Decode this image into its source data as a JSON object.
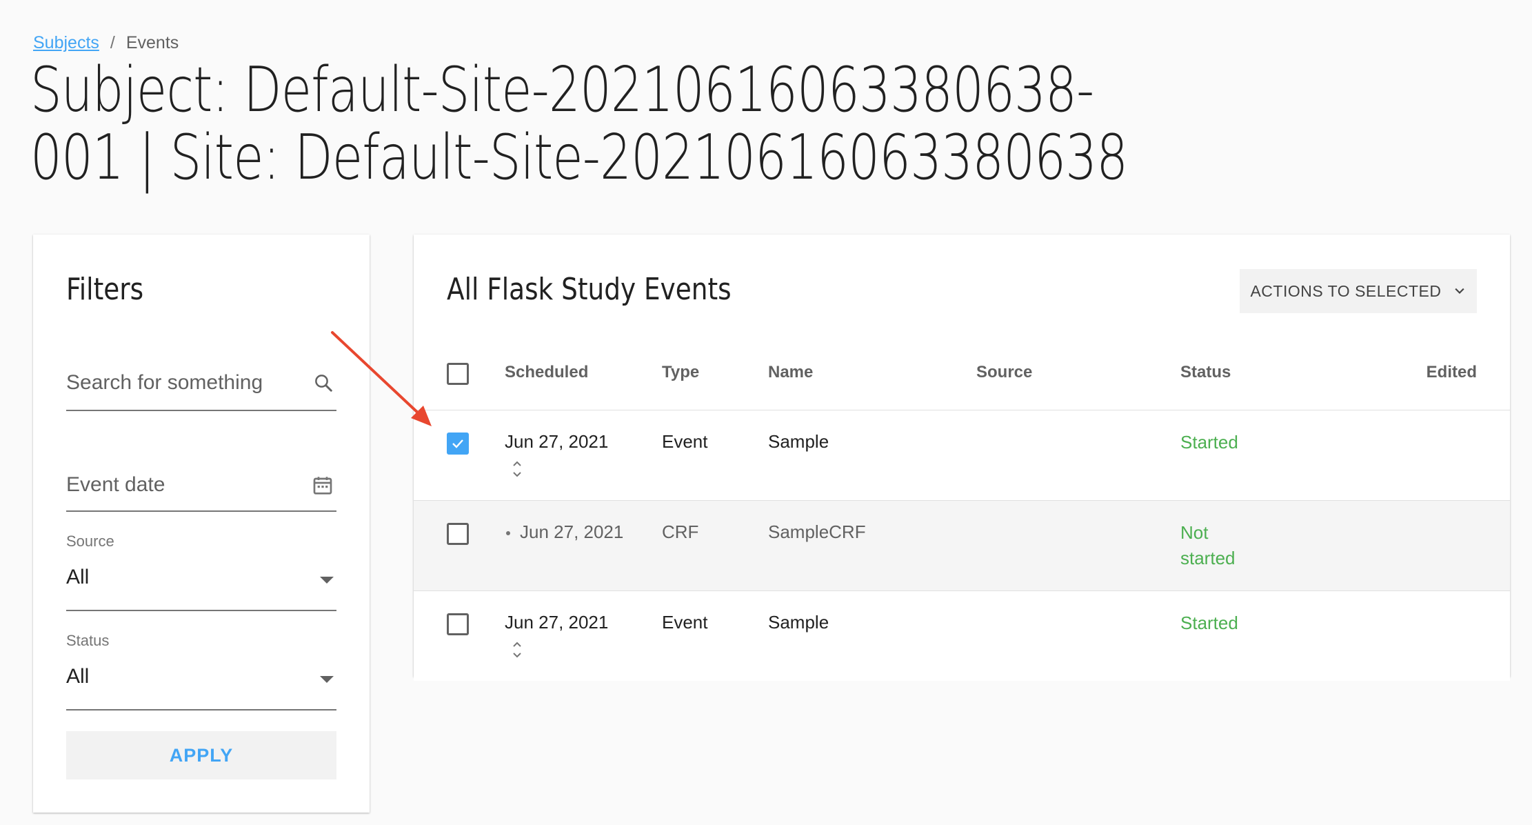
{
  "breadcrumb": {
    "link": "Subjects",
    "separator": "/",
    "current": "Events"
  },
  "page_title": "Subject: Default-Site-20210616063380638-001 | Site: Default-Site-20210616063380638",
  "filters": {
    "title": "Filters",
    "search_placeholder": "Search for something",
    "event_date_placeholder": "Event date",
    "source_label": "Source",
    "source_value": "All",
    "status_label": "Status",
    "status_value": "All",
    "apply_label": "APPLY"
  },
  "events": {
    "title": "All Flask Study Events",
    "actions_label": "ACTIONS TO SELECTED",
    "columns": [
      "Scheduled",
      "Type",
      "Name",
      "Source",
      "Status",
      "Edited"
    ],
    "rows": [
      {
        "scheduled": "Jun 27, 2021",
        "type": "Event",
        "name": "Sample",
        "source": "",
        "status": "Started",
        "edited": "",
        "checked": true
      },
      {
        "scheduled": "Jun 27, 2021",
        "type": "CRF",
        "name": "SampleCRF",
        "source": "",
        "status": "Not started",
        "edited": "",
        "checked": false
      },
      {
        "scheduled": "Jun 27, 2021",
        "type": "Event",
        "name": "Sample",
        "source": "",
        "status": "Started",
        "edited": "",
        "checked": false
      }
    ]
  },
  "colors": {
    "accent": "#42a5f5",
    "status_green": "#4caf50",
    "annotation_arrow": "#e8472f"
  },
  "icons": {
    "search": "search-icon",
    "calendar": "calendar-icon",
    "dropdown": "caret-down-icon",
    "actions_chevron": "chevron-down-icon",
    "sort": "sort-icon",
    "check": "checkmark-icon",
    "annotation": "arrow-annotation"
  }
}
